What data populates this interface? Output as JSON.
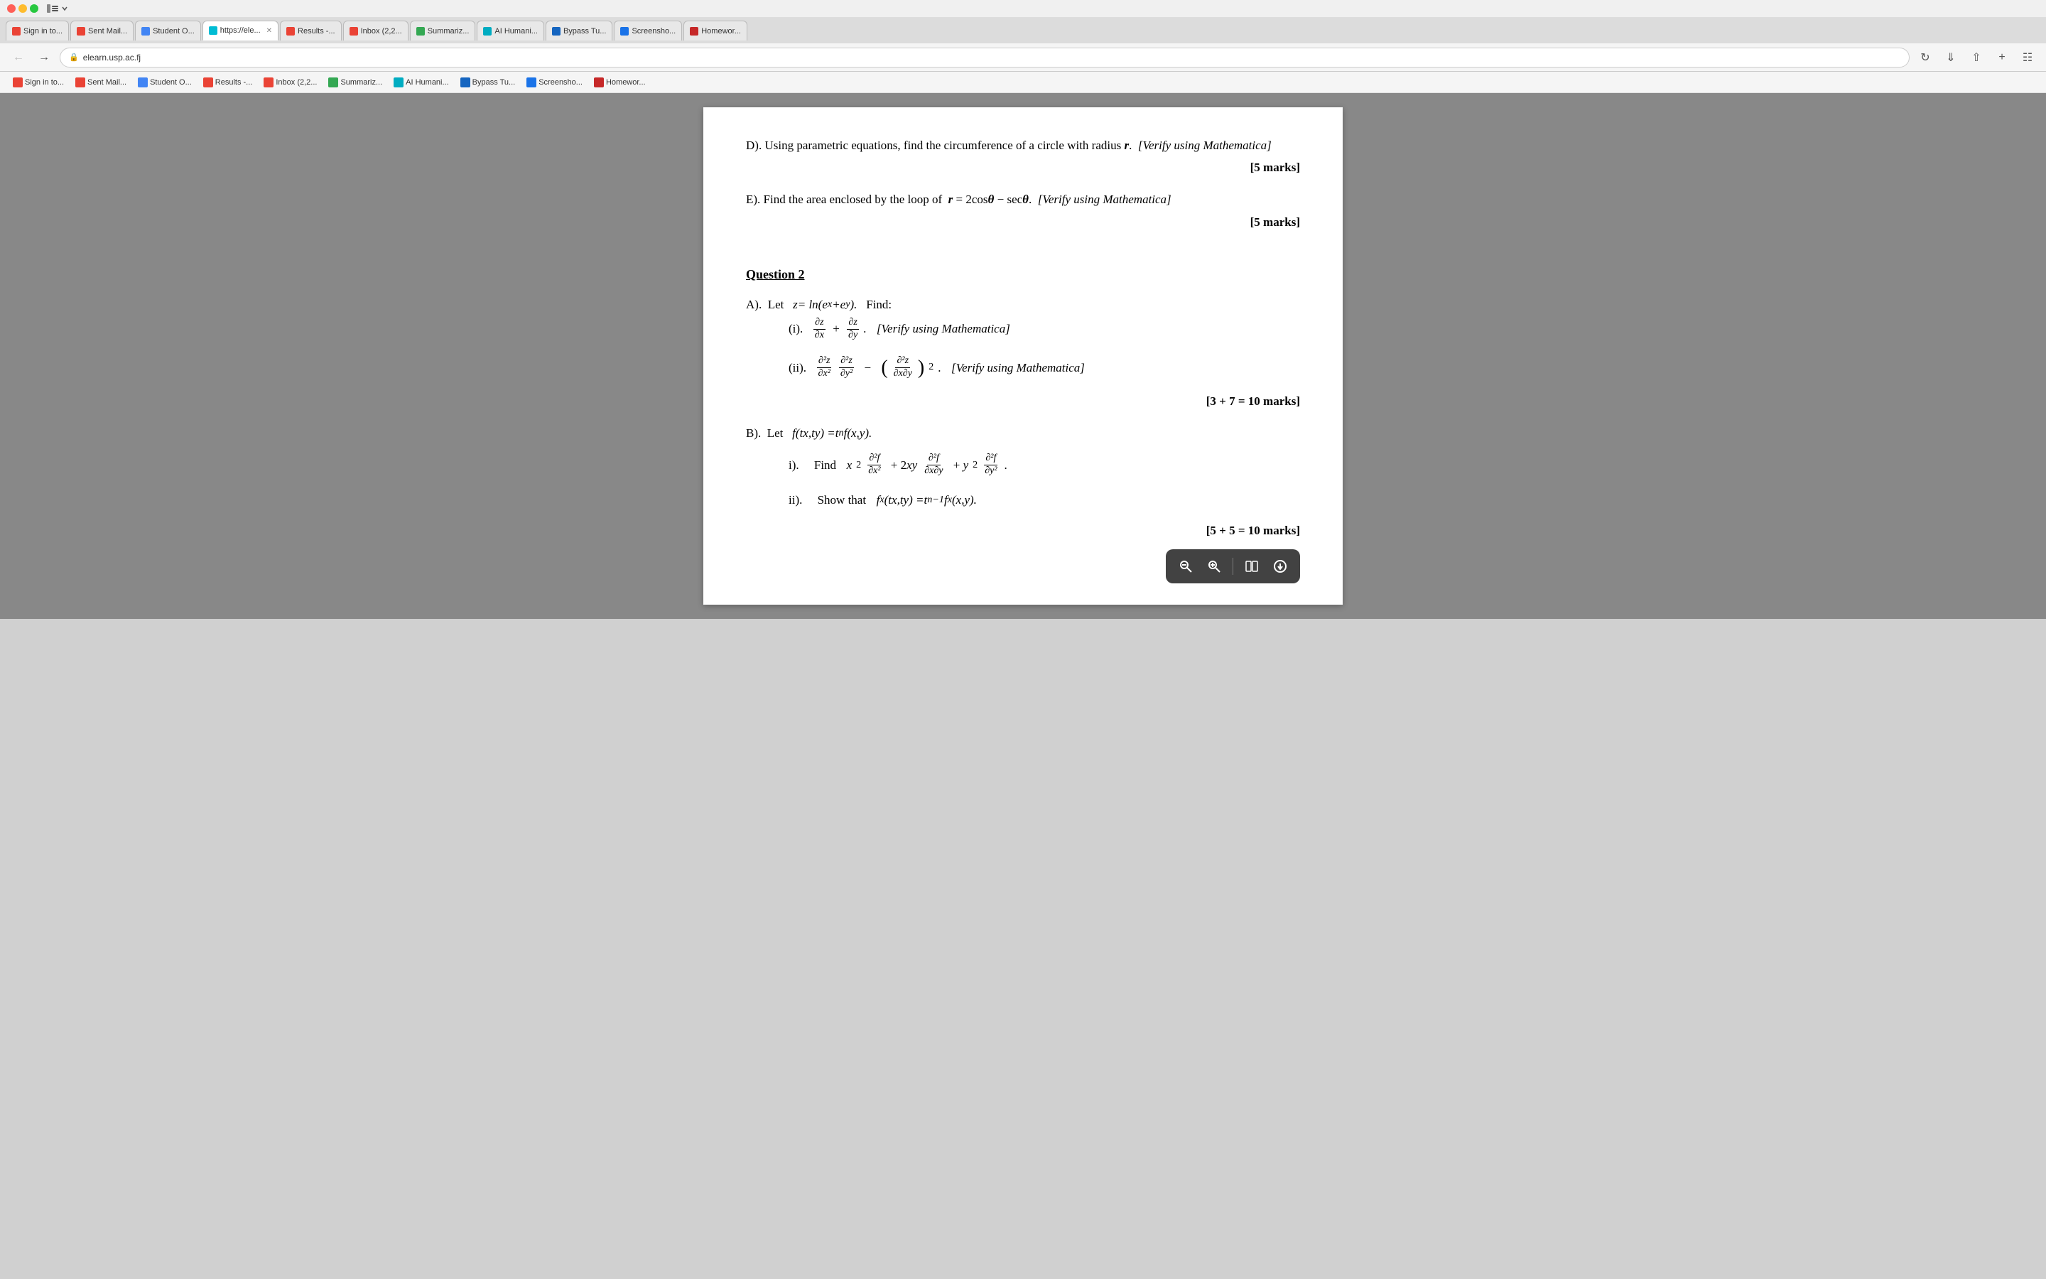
{
  "browser": {
    "url": "elearn.usp.ac.fj",
    "tabs": [
      {
        "id": "tab1",
        "label": "Sign in to...",
        "icon_color": "gmail-red",
        "active": false
      },
      {
        "id": "tab2",
        "label": "Sent Mail...",
        "icon_color": "gmail-red2",
        "active": false
      },
      {
        "id": "tab3",
        "label": "Student O...",
        "icon_color": "student-green",
        "active": false
      },
      {
        "id": "tab4",
        "label": "https://ele...",
        "icon_color": "ele-blue",
        "active": true,
        "closeable": true
      },
      {
        "id": "tab5",
        "label": "Results -...",
        "icon_color": "gmail-red3",
        "active": false
      },
      {
        "id": "tab6",
        "label": "Inbox (2,2...",
        "icon_color": "gmail-red4",
        "active": false
      },
      {
        "id": "tab7",
        "label": "Summariz...",
        "icon_color": "summarize-green",
        "active": false
      },
      {
        "id": "tab8",
        "label": "AI Humani...",
        "icon_color": "ai-teal",
        "active": false
      },
      {
        "id": "tab9",
        "label": "Bypass Tu...",
        "icon_color": "bypass-blue",
        "active": false
      },
      {
        "id": "tab10",
        "label": "Screensho...",
        "icon_color": "screenshot-blue",
        "active": false
      },
      {
        "id": "tab11",
        "label": "Homewor...",
        "icon_color": "hw-red",
        "active": false
      }
    ]
  },
  "content": {
    "partD": {
      "label": "D).",
      "text": "Using parametric equations, find the circumference of a circle with radius",
      "r_var": "r",
      "separator": ".",
      "verify": "[Verify using Mathematica]",
      "marks": "[5 marks]"
    },
    "partE": {
      "label": "E).",
      "text": "Find the area enclosed by the loop of",
      "equation": "r = 2cosθ − secθ.",
      "verify": "[Verify using Mathematica]",
      "marks": "[5 marks]"
    },
    "question2": {
      "heading": "Question 2",
      "partA": {
        "label": "A).",
        "text": "Let",
        "equation": "z = ln(eˣ + eʸ).",
        "find": "Find:",
        "subI": {
          "label": "(i).",
          "equation": "∂z/∂x + ∂z/∂y",
          "verify": "[Verify using Mathematica]"
        },
        "subII": {
          "label": "(ii).",
          "equation": "(∂²z/∂x²)(∂²z/∂y²) − (∂²z/∂x∂y)²",
          "verify": "[Verify using Mathematica]"
        },
        "marks": "[3 + 7 = 10 marks]"
      },
      "partB": {
        "label": "B).",
        "text": "Let",
        "equation": "f(tx, ty) = tⁿ f(x, y).",
        "subI": {
          "label": "i).",
          "text": "Find",
          "equation": "x²(∂²f/∂x²) + 2xy(∂²f/∂x∂y) + y²(∂²f/∂y²)"
        },
        "subII": {
          "label": "ii).",
          "text": "Show that",
          "equation": "fₓ(tx, ty) = tⁿ⁻¹ fₓ(x, y)."
        },
        "marks": "[5 + 5 = 10 marks]"
      }
    }
  },
  "floating_toolbar": {
    "buttons": [
      {
        "name": "zoom-out",
        "icon": "🔍",
        "label": "Zoom out"
      },
      {
        "name": "zoom-in",
        "icon": "🔍",
        "label": "Zoom in"
      },
      {
        "name": "reader-view",
        "icon": "⊞",
        "label": "Reader view"
      },
      {
        "name": "download",
        "icon": "⬇",
        "label": "Download"
      }
    ]
  }
}
